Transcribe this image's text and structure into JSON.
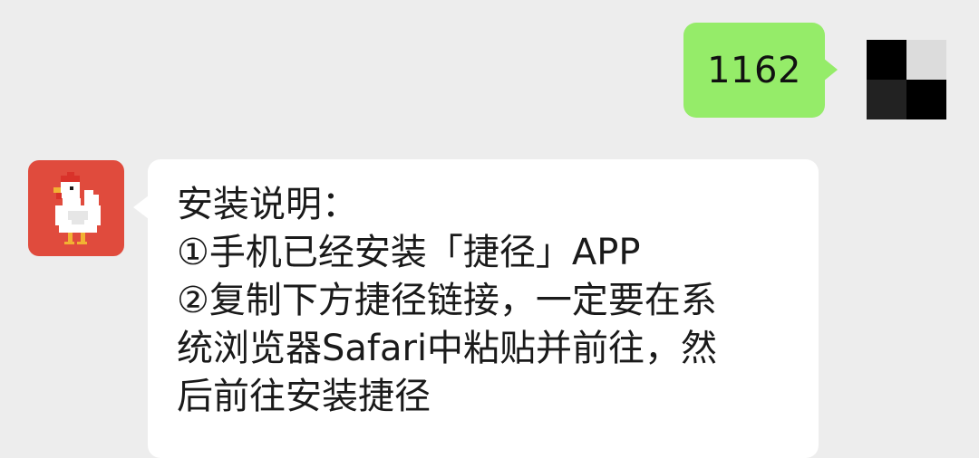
{
  "chat": {
    "outgoing": {
      "text": "1162",
      "bubble_color": "#95ec69"
    },
    "outgoing_avatar": {
      "colors": [
        "#000000",
        "#dcdcdc",
        "#222222",
        "#000000"
      ]
    },
    "incoming_avatar": {
      "icon": "chicken-icon",
      "background": "#e04b3d"
    },
    "incoming": {
      "lines": [
        "安装说明：",
        "①手机已经安装「捷径」APP",
        "②复制下方捷径链接，一定要在系",
        "统浏览器Safari中粘贴并前往，然",
        "后前往安装捷径"
      ]
    }
  }
}
